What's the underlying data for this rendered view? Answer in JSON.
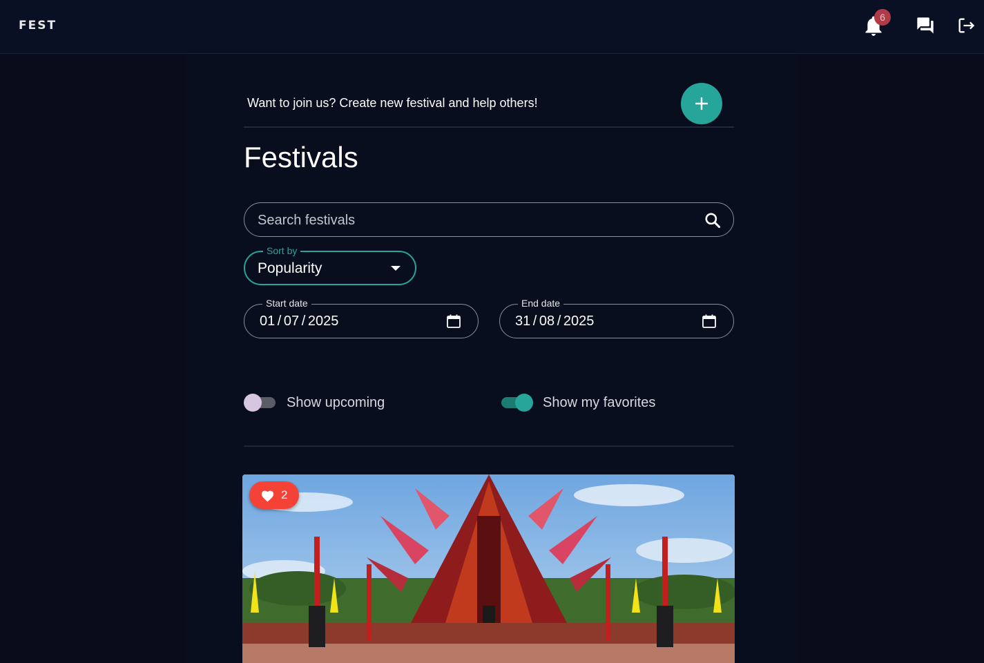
{
  "app": {
    "brand": "FEST",
    "notifications": {
      "count": "6",
      "icon": "bell-icon"
    },
    "chat_icon": "chat-icon",
    "logout_icon": "logout-icon"
  },
  "join": {
    "text": "Want to join us? Create new festival and help others!",
    "add_icon": "plus-icon"
  },
  "page": {
    "title": "Festivals"
  },
  "search": {
    "placeholder": "Search festivals",
    "value": "",
    "icon": "search-icon"
  },
  "sort": {
    "label": "Sort by",
    "value": "Popularity"
  },
  "dates": {
    "start": {
      "label": "Start date",
      "value": "01 / 07 / 2025"
    },
    "end": {
      "label": "End date",
      "value": "31 / 08 / 2025"
    }
  },
  "toggles": {
    "upcoming": {
      "label": "Show upcoming",
      "checked": false
    },
    "favorites": {
      "label": "Show my favorites",
      "checked": true
    }
  },
  "festival_card": {
    "likes": "2",
    "like_icon": "heart-icon"
  },
  "colors": {
    "background": "#090e1e",
    "accent": "#26a69a",
    "like": "#f44336",
    "badge": "#b03a48"
  }
}
